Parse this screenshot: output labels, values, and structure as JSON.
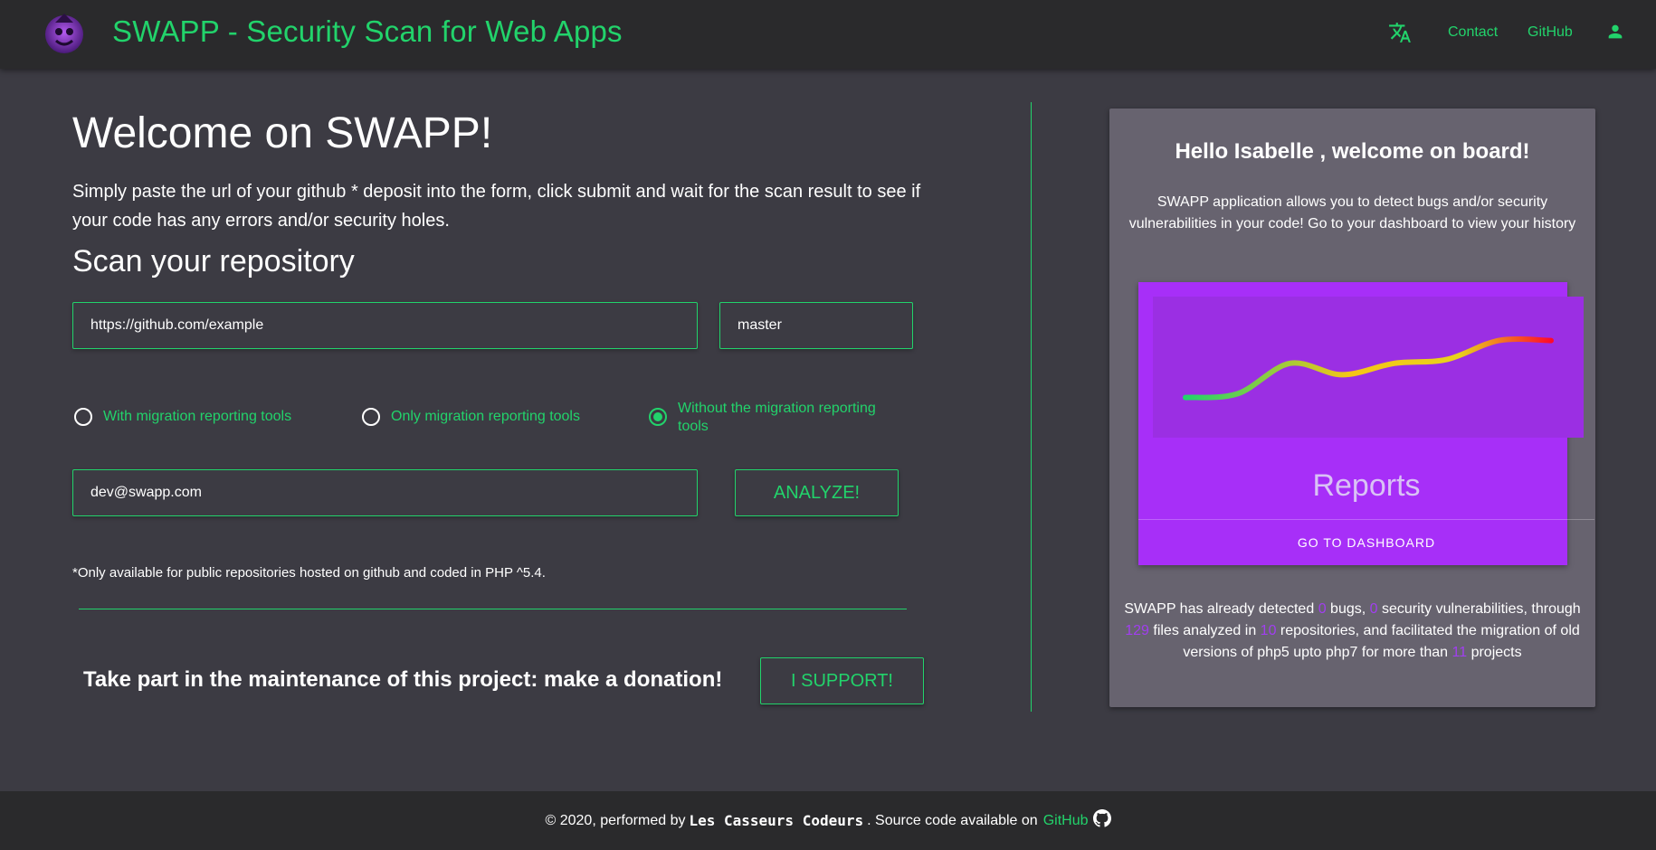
{
  "header": {
    "title": "SWAPP - Security Scan for Web Apps",
    "nav": {
      "contact": "Contact",
      "github": "GitHub"
    },
    "icons": {
      "logo": "swapp-logo-icon",
      "translate": "translate-icon",
      "account": "account-icon"
    }
  },
  "main": {
    "welcome": "Welcome on SWAPP!",
    "intro": "Simply paste the url of your github * deposit into the form, click submit and wait for the scan result to see if your code has any errors and/or security holes.",
    "scan_title": "Scan your repository",
    "repo_input": {
      "value": "https://github.com/example"
    },
    "branch_input": {
      "value": "master"
    },
    "options": [
      {
        "label": "With migration reporting tools",
        "checked": false
      },
      {
        "label": "Only migration reporting tools",
        "checked": false
      },
      {
        "label": "Without the migration reporting tools",
        "checked": true
      }
    ],
    "email_input": {
      "value": "dev@swapp.com"
    },
    "analyze_label": "ANALYZE!",
    "note": "*Only available for public repositories hosted on github and coded in PHP ^5.4.",
    "donate_text": "Take part in the maintenance of this project: make a donation!",
    "support_label": "I SUPPORT!"
  },
  "card": {
    "hello": "Hello Isabelle , welcome on board!",
    "description": "SWAPP application allows you to detect bugs and/or security vulnerabilities in your code! Go to your dashboard to view your history",
    "reports_title": "Reports",
    "dashboard_label": "GO TO DASHBOARD",
    "stats": {
      "part1": "SWAPP has already detected",
      "bugs": "0",
      "part2": "bugs,",
      "vulns": "0",
      "part3": "security vulnerabilities, through",
      "files": "129",
      "part4": "files analyzed in",
      "repos": "10",
      "part5": "repositories, and facilitated the migration of old versions of php5 upto php7 for more than",
      "projects": "11",
      "part6": "projects"
    }
  },
  "chart_data": {
    "type": "line",
    "x": [
      0,
      1,
      2,
      3,
      4,
      5,
      6,
      7
    ],
    "values": [
      2,
      3,
      11,
      8,
      11,
      12,
      17,
      17
    ],
    "gradient": [
      "#22d36b",
      "#f5c518",
      "#ff0a2a"
    ]
  },
  "footer": {
    "prefix": "© 2020, performed by",
    "team": "Les Casseurs Codeurs",
    "middle": ". Source code available on",
    "github": "GitHub"
  },
  "colors": {
    "accent": "#22d36b",
    "purple": "#a72ff8",
    "background": "#3c3b43",
    "bar": "#2a2a2c"
  }
}
